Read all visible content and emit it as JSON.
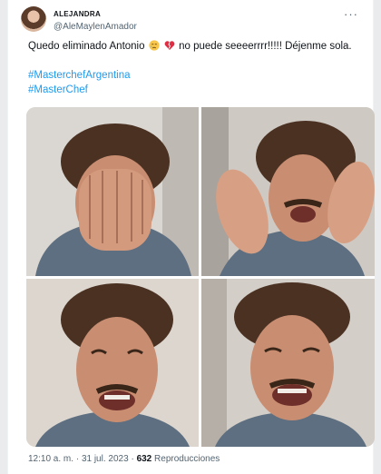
{
  "tweet": {
    "display_name": "ALEJANDRA",
    "handle": "@AleMaylenAmador",
    "text_start": "Quedo eliminado Antonio",
    "text_end": "no puede seeeerrrr!!!!! Déjenme sola.",
    "emojis": [
      "crying-face-emoji",
      "broken-heart-emoji"
    ],
    "hashtags": [
      "#MasterchefArgentina",
      "#MasterChef"
    ],
    "time": "12:10 a. m.",
    "separator": "·",
    "date": "31 jul. 2023",
    "views_count": "632",
    "views_label": "Reproducciones"
  },
  "media": {
    "panels": [
      "face-in-hands",
      "waving-hands-crying",
      "crying-face",
      "crying-face-close"
    ]
  },
  "colors": {
    "hashtag": "#1d9bf0",
    "secondary_text": "#536471",
    "primary_text": "#0f1419",
    "shirt": "#5d6f80",
    "hair": "#4a3122",
    "skin": "#c98e72"
  }
}
